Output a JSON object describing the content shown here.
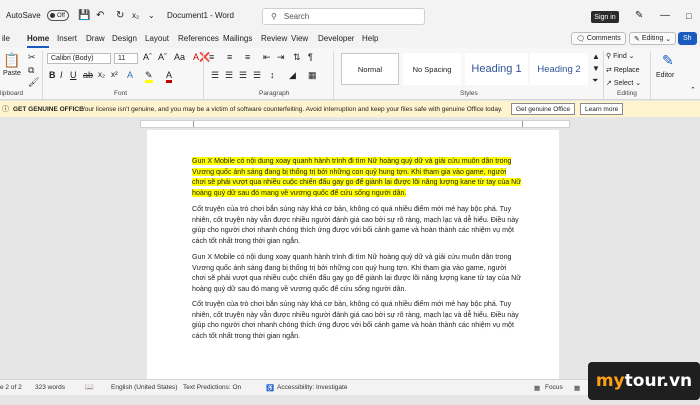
{
  "titlebar": {
    "autosave_label": "AutoSave",
    "autosave_state": "Off",
    "doc_title": "Document1 - Word",
    "search_placeholder": "Search",
    "signin_label": "Sign in"
  },
  "menu": {
    "tabs": [
      "ile",
      "Home",
      "Insert",
      "Draw",
      "Design",
      "Layout",
      "References",
      "Mailings",
      "Review",
      "View",
      "Developer",
      "Help"
    ],
    "comments_label": "Comments",
    "editing_label": "Editing",
    "share_label": "Sh"
  },
  "ribbon": {
    "paste_label": "Paste",
    "font_name": "Calibri (Body)",
    "font_size": "11",
    "groups": {
      "clipboard": "lipboard",
      "font": "Font",
      "paragraph": "Paragraph",
      "styles": "Styles",
      "editing": "Editing"
    },
    "styles": [
      "Normal",
      "No Spacing",
      "Heading 1",
      "Heading 2"
    ],
    "find_label": "Find",
    "replace_label": "Replace",
    "select_label": "Select",
    "editor_label": "Editor"
  },
  "message_bar": {
    "title": "GET GENUINE OFFICE",
    "text": "Your license isn't genuine, and you may be a victim of software counterfeiting. Avoid interruption and keep your files safe with genuine Office today.",
    "primary_button": "Get genuine Office",
    "secondary_button": "Learn more"
  },
  "document": {
    "paragraphs": [
      "Gun X Mobile có nội dung xoay quanh hành trình đi tìm Nữ hoàng quỷ dữ và giải cứu muôn dân trong Vương quốc ánh sáng đang bị thống trị bởi những con quỷ hung tợn. Khi tham gia vào game, người chơi sẽ phải vượt qua nhiều cuộc chiến đấu gay go để giành lại được lõi năng lượng kane từ tay của Nữ hoàng quỷ dữ sau đó mang về vương quốc để cứu sống người dân.",
      "Cốt truyện của trò chơi bắn súng này khá cơ bản, không có quá nhiều điểm mới mẻ hay bộc phá. Tuy nhiên, cốt truyện này vẫn được nhiều người đánh giá cao bởi sự rõ ràng, mạch lạc và dễ hiểu. Điều này giúp cho người chơi nhanh chóng thích ứng được với bối cảnh game và hoàn thành các nhiệm vụ một cách tốt nhất trong thời gian ngắn.",
      "Gun X Mobile có nội dung xoay quanh hành trình đi tìm Nữ hoàng quỷ dữ và giải cứu muôn dân trong Vương quốc ánh sáng đang bị thống trị bởi những con quỷ hung tợn. Khi tham gia vào game, người chơi sẽ phải vượt qua nhiều cuộc chiến đấu gay go để giành lại được lõi năng lượng kane từ tay của Nữ hoàng quỷ dữ sau đó mang về vương quốc để cứu sống người dân.",
      "Cốt truyện của trò chơi bắn súng này khá cơ bản, không có quá nhiều điểm mới mẻ hay bộc phá. Tuy nhiên, cốt truyện này vẫn được nhiều người đánh giá cao bởi sự rõ ràng, mạch lạc và dễ hiểu. Điều này giúp cho người chơi nhanh chóng thích ứng được với bối cảnh game và hoàn thành các nhiệm vụ một cách tốt nhất trong thời gian ngắn."
    ]
  },
  "status": {
    "page": "e 2 of 2",
    "words": "323 words",
    "language": "English (United States)",
    "text_predictions": "Text Predictions: On",
    "accessibility": "Accessibility: Investigate",
    "focus": "Focus"
  },
  "watermark": {
    "prefix": "my",
    "suffix": "tour.vn"
  },
  "colors": {
    "accent": "#185abd",
    "highlight": "#ffff00",
    "message_bar": "#fff4ce"
  }
}
